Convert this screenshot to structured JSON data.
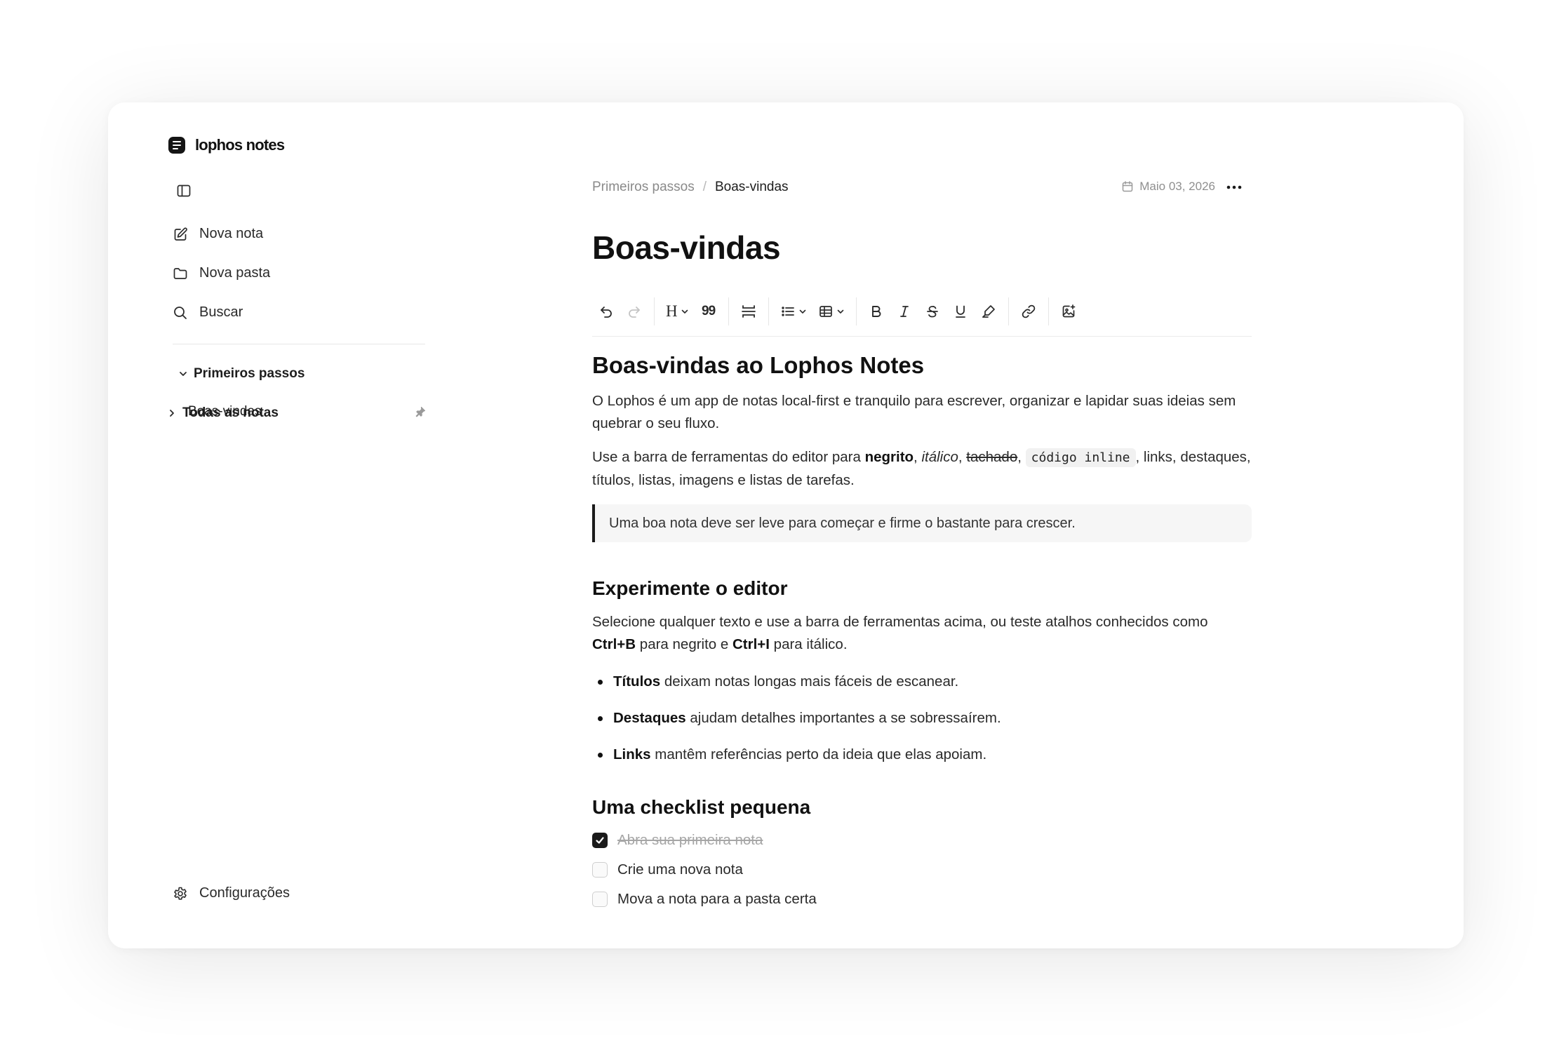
{
  "app": {
    "name": "lophos notes"
  },
  "sidebar": {
    "actions": [
      {
        "label": "Nova nota",
        "icon": "edit-icon"
      },
      {
        "label": "Nova pasta",
        "icon": "folder-icon"
      },
      {
        "label": "Buscar",
        "icon": "search-icon"
      }
    ],
    "tree": {
      "folder": {
        "label": "Primeiros passos",
        "expanded": true
      },
      "note": {
        "label": "Boas-vindas",
        "pinned": true
      },
      "all_notes": {
        "label": "Todas as notas",
        "expanded": false
      }
    },
    "settings_label": "Configurações"
  },
  "header": {
    "breadcrumb_parent": "Primeiros passos",
    "breadcrumb_sep": "/",
    "breadcrumb_current": "Boas-vindas",
    "date": "Maio 03, 2026"
  },
  "note": {
    "title": "Boas-vindas",
    "h1": "Boas-vindas ao Lophos Notes",
    "p1": "O Lophos é um app de notas local-first e tranquilo para escrever, organizar e lapidar suas ideias sem quebrar o seu fluxo.",
    "p2": {
      "t1": "Use a barra de ferramentas do editor para ",
      "bold": "negrito",
      "t2": ", ",
      "italic": "itálico",
      "t3": ", ",
      "strike": "tachado",
      "t4": ", ",
      "code": "código inline",
      "t5": ", links, destaques, títulos, listas, imagens e listas de tarefas."
    },
    "quote": "Uma boa nota deve ser leve para começar e firme o bastante para crescer.",
    "h2a": "Experimente o editor",
    "p3": {
      "t1": "Selecione qualquer texto e use a barra de ferramentas acima, ou teste atalhos conhecidos como ",
      "k1": "Ctrl+B",
      "t2": " para negrito e ",
      "k2": "Ctrl+I",
      "t3": " para itálico."
    },
    "bullets": [
      {
        "bold": "Títulos",
        "text": " deixam notas longas mais fáceis de escanear."
      },
      {
        "bold": "Destaques",
        "text": " ajudam detalhes importantes a se sobressaírem."
      },
      {
        "bold": "Links",
        "text": " mantêm referências perto da ideia que elas apoiam."
      }
    ],
    "h2b": "Uma checklist pequena",
    "checklist": [
      {
        "label": "Abra sua primeira nota",
        "checked": true
      },
      {
        "label": "Crie uma nova nota",
        "checked": false
      },
      {
        "label": "Mova a nota para a pasta certa",
        "checked": false
      }
    ]
  },
  "toolbar": {
    "heading_glyph": "H",
    "quote_glyph": "99",
    "items": [
      "undo-icon",
      "redo-icon",
      "heading-icon",
      "blockquote-icon",
      "horizontal-rule-icon",
      "list-icon",
      "table-icon",
      "bold-icon",
      "italic-icon",
      "strikethrough-icon",
      "underline-icon",
      "highlight-icon",
      "link-icon",
      "image-icon"
    ]
  },
  "colors": {
    "accent": "#1a1a1a",
    "muted": "#8a8a8a",
    "quote_bg": "#f6f6f6"
  }
}
